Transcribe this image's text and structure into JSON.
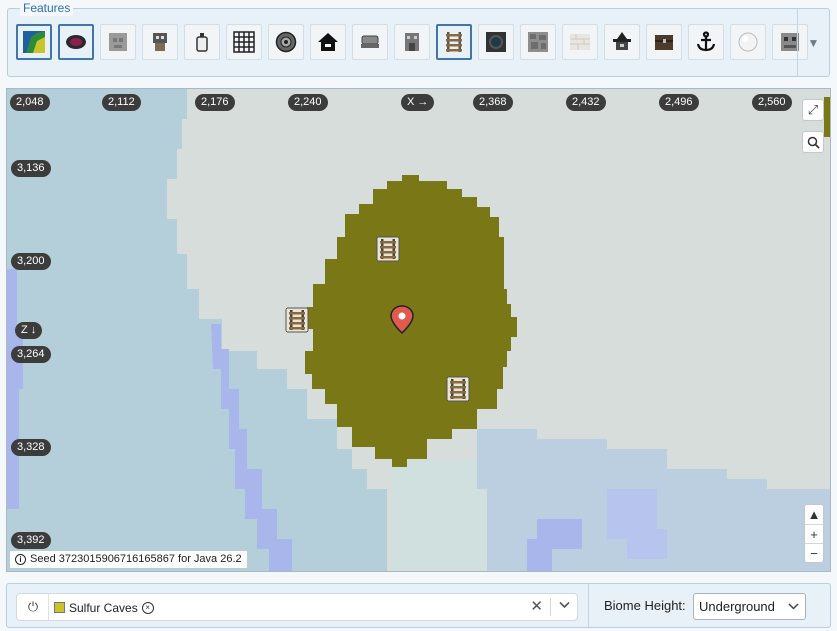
{
  "features": {
    "legend": "Features",
    "items": [
      {
        "name": "feature-biome-map",
        "icon": "map-icon",
        "active": true
      },
      {
        "name": "feature-ruined-portal",
        "icon": "portal-icon",
        "active": true
      },
      {
        "name": "feature-stone-block",
        "icon": "stone-icon",
        "active": false
      },
      {
        "name": "feature-pillager-outpost",
        "icon": "outpost-icon",
        "active": false
      },
      {
        "name": "feature-bottle",
        "icon": "bottle-icon",
        "active": false
      },
      {
        "name": "feature-grid",
        "icon": "grid-icon",
        "active": false
      },
      {
        "name": "feature-ocean-monument",
        "icon": "monument-icon",
        "active": false
      },
      {
        "name": "feature-house",
        "icon": "house-icon",
        "active": false
      },
      {
        "name": "feature-minecart",
        "icon": "minecart-icon",
        "active": false
      },
      {
        "name": "feature-mansion",
        "icon": "mansion-icon",
        "active": false
      },
      {
        "name": "feature-mineshaft-rails",
        "icon": "rails-icon",
        "active": true
      },
      {
        "name": "feature-ancient-city",
        "icon": "ancient-city-icon",
        "active": false
      },
      {
        "name": "feature-cobblestone",
        "icon": "cobblestone-icon",
        "active": false
      },
      {
        "name": "feature-desert-temple",
        "icon": "sandstone-icon",
        "active": false
      },
      {
        "name": "feature-witch-hut",
        "icon": "witch-hut-icon",
        "active": false
      },
      {
        "name": "feature-treasure-chest",
        "icon": "chest-icon",
        "active": false
      },
      {
        "name": "feature-shipwreck",
        "icon": "anchor-icon",
        "active": false
      },
      {
        "name": "feature-snow-ball",
        "icon": "snowball-icon",
        "active": false
      },
      {
        "name": "feature-trail-ruins",
        "icon": "ruins-icon",
        "active": false
      }
    ],
    "toggle_icon": "▼"
  },
  "map": {
    "x_ticks": [
      "2,048",
      "2,112",
      "2,176",
      "2,240",
      "X →",
      "2,368",
      "2,432",
      "2,496",
      "2,560"
    ],
    "z_ticks": [
      "3,136",
      "3,200",
      "Z ↓",
      "3,264",
      "3,328",
      "3,392"
    ],
    "seed_text": "Seed 3723015906716165867 for Java 26.2",
    "info_icon": "i",
    "fullscreen_icon": "⤢",
    "search_icon": "⌕",
    "north_icon": "▲",
    "zoom_in": "+",
    "zoom_out": "−",
    "colors": {
      "sulfur_caves": "#7a7717",
      "land": "#d7dddb",
      "water_light": "#b4cfd9",
      "water_deep": "#a8b6ec",
      "plains": "#cfe0df"
    }
  },
  "biome_filter": {
    "power_icon": "⏻",
    "chip_label": "Sulfur Caves",
    "chip_color": "#c9c42a",
    "chip_remove_icon": "×",
    "clear_icon": "✕",
    "dropdown_icon": "⌄"
  },
  "biome_height": {
    "label": "Biome Height:",
    "value": "Underground",
    "chevron": "⌄"
  }
}
